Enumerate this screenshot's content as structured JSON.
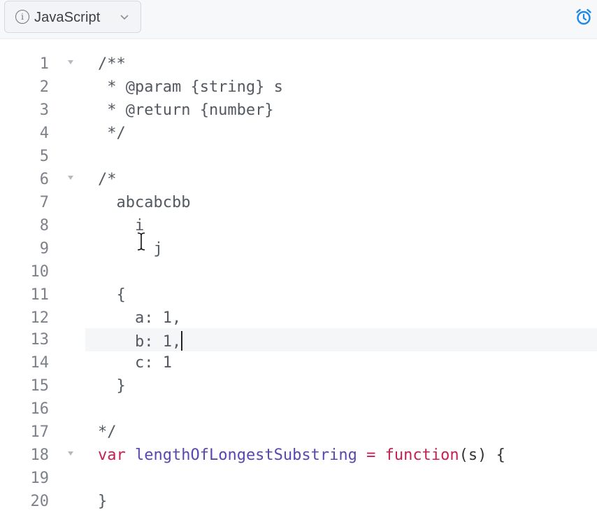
{
  "toolbar": {
    "language": "JavaScript"
  },
  "editor": {
    "lines": [
      {
        "number": "1",
        "text": "/**"
      },
      {
        "number": "2",
        "text": " * @param {string} s"
      },
      {
        "number": "3",
        "text": " * @return {number}"
      },
      {
        "number": "4",
        "text": " */"
      },
      {
        "number": "5",
        "text": ""
      },
      {
        "number": "6",
        "text": "/*"
      },
      {
        "number": "7",
        "text": "  abcabcbb"
      },
      {
        "number": "8",
        "text": "    i"
      },
      {
        "number": "9",
        "text": "      j"
      },
      {
        "number": "10",
        "text": ""
      },
      {
        "number": "11",
        "text": "  {"
      },
      {
        "number": "12",
        "text": "    a: 1,"
      },
      {
        "number": "13",
        "text": "    b: 1,"
      },
      {
        "number": "14",
        "text": "    c: 1"
      },
      {
        "number": "15",
        "text": "  }"
      },
      {
        "number": "16",
        "text": ""
      },
      {
        "number": "17",
        "text": "*/"
      },
      {
        "number": "18",
        "tokens": {
          "kw1": "var",
          "name": "lengthOfLongestSubstring",
          "op": " = ",
          "kw2": "function",
          "args": "(s) {"
        }
      },
      {
        "number": "19",
        "text": ""
      },
      {
        "number": "20",
        "text": "}"
      }
    ],
    "active_line": "13",
    "colors": {
      "keyword": "#c81e52",
      "identifier": "#5a46b0",
      "comment": "#545961",
      "line_number": "#7d828a",
      "accent_icon": "#1e88e5"
    }
  }
}
